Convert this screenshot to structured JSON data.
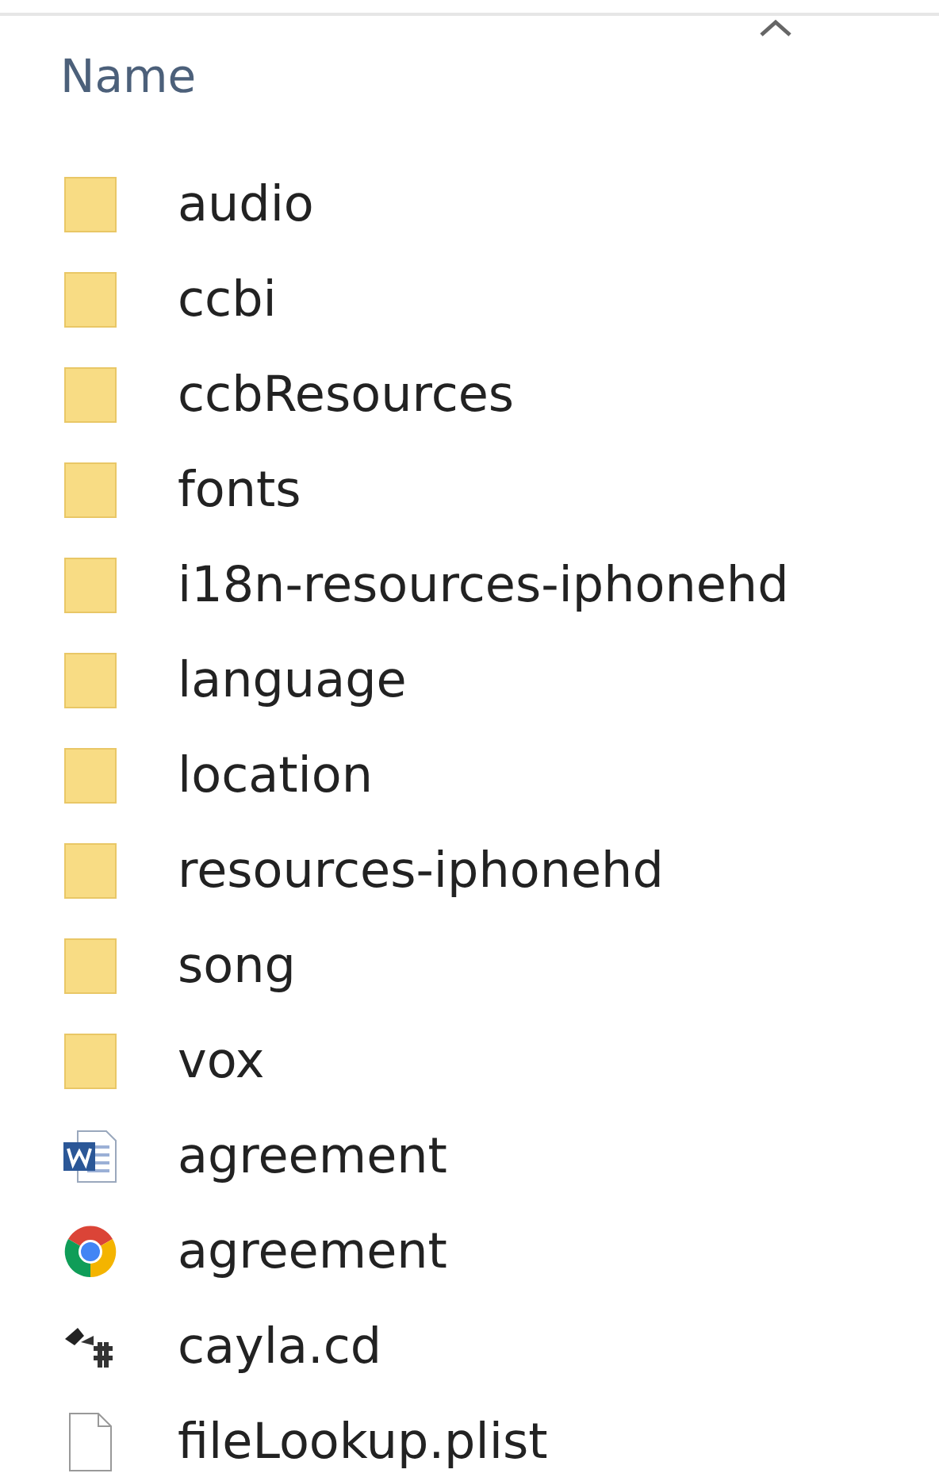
{
  "column_header": {
    "label": "Name",
    "sorted_ascending": true
  },
  "files": [
    {
      "name": "audio",
      "kind": "folder"
    },
    {
      "name": "ccbi",
      "kind": "folder"
    },
    {
      "name": "ccbResources",
      "kind": "folder"
    },
    {
      "name": "fonts",
      "kind": "folder"
    },
    {
      "name": "i18n-resources-iphonehd",
      "kind": "folder"
    },
    {
      "name": "language",
      "kind": "folder"
    },
    {
      "name": "location",
      "kind": "folder"
    },
    {
      "name": "resources-iphonehd",
      "kind": "folder"
    },
    {
      "name": "song",
      "kind": "folder"
    },
    {
      "name": "vox",
      "kind": "folder"
    },
    {
      "name": "agreement",
      "kind": "word"
    },
    {
      "name": "agreement",
      "kind": "chrome"
    },
    {
      "name": "cayla.cd",
      "kind": "binary"
    },
    {
      "name": "fileLookup.plist",
      "kind": "file"
    }
  ]
}
